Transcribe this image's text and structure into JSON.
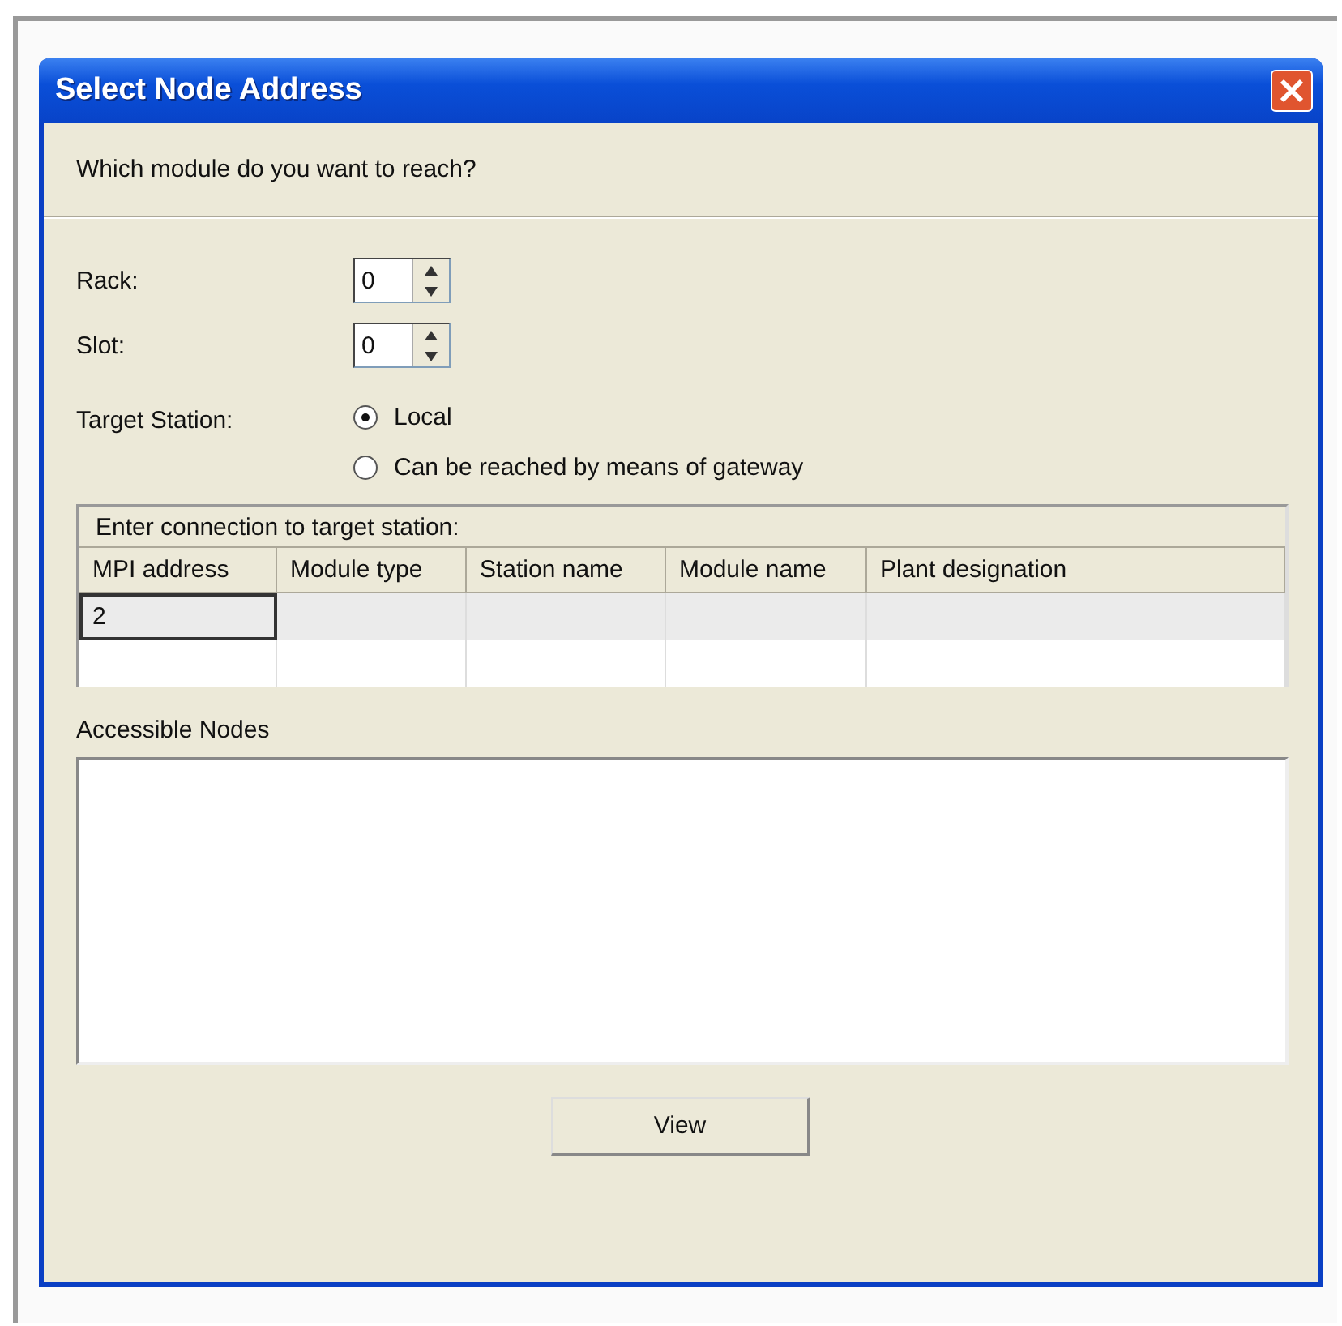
{
  "window": {
    "title": "Select Node Address"
  },
  "prompt": "Which module do you want to reach?",
  "fields": [
    {
      "label": "Rack:",
      "value": "0"
    },
    {
      "label": "Slot:",
      "value": "0"
    }
  ],
  "target_station": {
    "label": "Target Station:",
    "options": [
      {
        "label": "Local",
        "selected": true
      },
      {
        "label": "Can be reached by means of gateway",
        "selected": false
      }
    ]
  },
  "connection_table": {
    "caption": "Enter connection to target station:",
    "columns": [
      "MPI address",
      "Module type",
      "Station name",
      "Module name",
      "Plant designation"
    ],
    "rows": [
      {
        "mpi_address": "2",
        "focused": true
      }
    ]
  },
  "accessible_nodes": {
    "label": "Accessible Nodes"
  },
  "buttons": [
    "View"
  ]
}
